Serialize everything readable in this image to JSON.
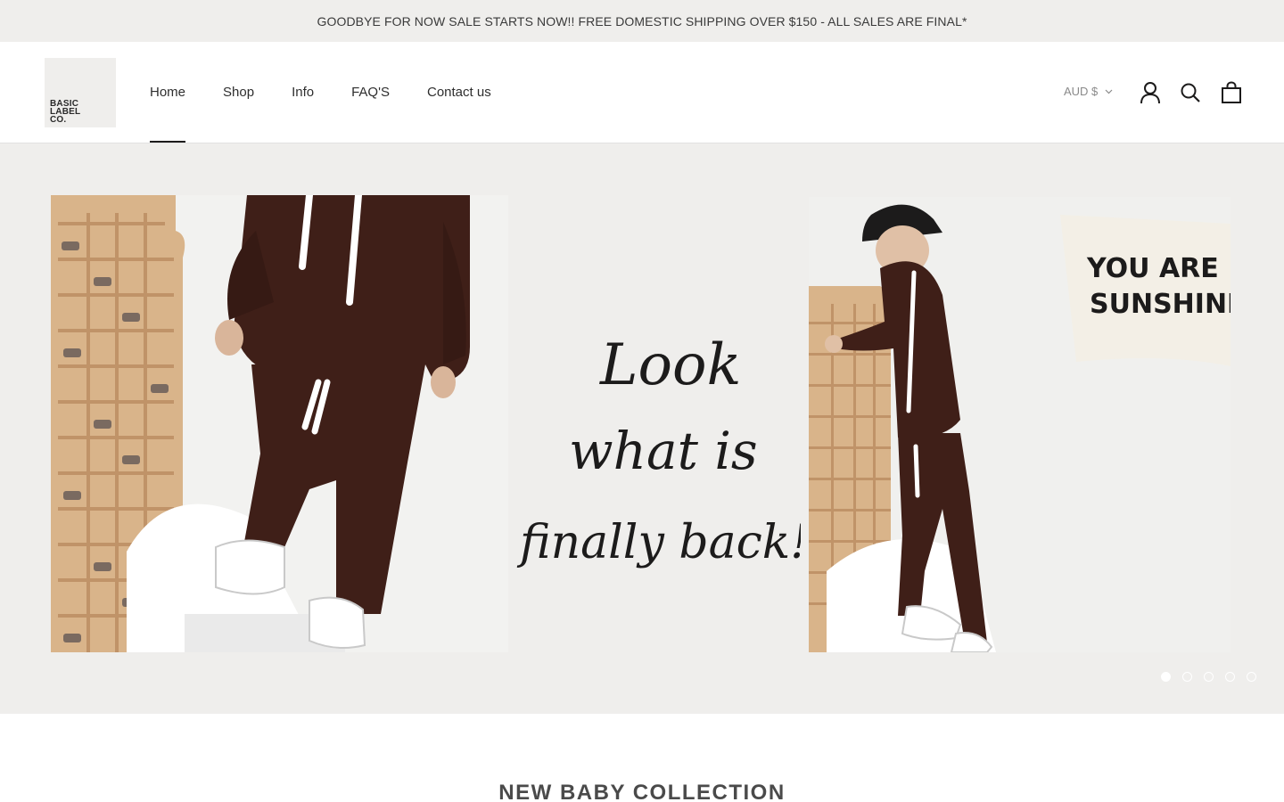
{
  "announcement": {
    "text": "GOODBYE FOR NOW SALE STARTS NOW!! FREE DOMESTIC SHIPPING OVER $150 - ALL SALES ARE FINAL*"
  },
  "logo": {
    "line1": "BASIC",
    "line2": "LABEL",
    "line3": "CO."
  },
  "nav": {
    "home": "Home",
    "shop": "Shop",
    "info": "Info",
    "faqs": "FAQ'S",
    "contact": "Contact us"
  },
  "header": {
    "currency": "AUD $",
    "icons": [
      "account-icon",
      "search-icon",
      "cart-icon"
    ]
  },
  "hero": {
    "script_line1": "Look",
    "script_line2": "what is",
    "script_line3": "finally back!",
    "banner_line1": "YOU ARE MY",
    "banner_line2": "SUNSHINE",
    "slide_count": 5,
    "active_slide": 1
  },
  "section": {
    "title": "NEW BABY COLLECTION"
  },
  "colors": {
    "background": "#efeeec",
    "text": "#1c1b1b",
    "garment": "#3f1f18"
  }
}
